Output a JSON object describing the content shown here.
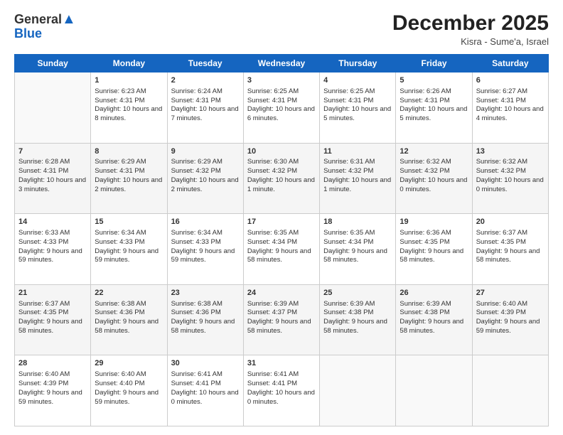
{
  "header": {
    "logo_general": "General",
    "logo_blue": "Blue",
    "month_title": "December 2025",
    "location": "Kisra - Sume'a, Israel"
  },
  "days_of_week": [
    "Sunday",
    "Monday",
    "Tuesday",
    "Wednesday",
    "Thursday",
    "Friday",
    "Saturday"
  ],
  "weeks": [
    [
      {
        "day": "",
        "content": ""
      },
      {
        "day": "1",
        "content": "Sunrise: 6:23 AM\nSunset: 4:31 PM\nDaylight: 10 hours and 8 minutes."
      },
      {
        "day": "2",
        "content": "Sunrise: 6:24 AM\nSunset: 4:31 PM\nDaylight: 10 hours and 7 minutes."
      },
      {
        "day": "3",
        "content": "Sunrise: 6:25 AM\nSunset: 4:31 PM\nDaylight: 10 hours and 6 minutes."
      },
      {
        "day": "4",
        "content": "Sunrise: 6:25 AM\nSunset: 4:31 PM\nDaylight: 10 hours and 5 minutes."
      },
      {
        "day": "5",
        "content": "Sunrise: 6:26 AM\nSunset: 4:31 PM\nDaylight: 10 hours and 5 minutes."
      },
      {
        "day": "6",
        "content": "Sunrise: 6:27 AM\nSunset: 4:31 PM\nDaylight: 10 hours and 4 minutes."
      }
    ],
    [
      {
        "day": "7",
        "content": "Sunrise: 6:28 AM\nSunset: 4:31 PM\nDaylight: 10 hours and 3 minutes."
      },
      {
        "day": "8",
        "content": "Sunrise: 6:29 AM\nSunset: 4:31 PM\nDaylight: 10 hours and 2 minutes."
      },
      {
        "day": "9",
        "content": "Sunrise: 6:29 AM\nSunset: 4:32 PM\nDaylight: 10 hours and 2 minutes."
      },
      {
        "day": "10",
        "content": "Sunrise: 6:30 AM\nSunset: 4:32 PM\nDaylight: 10 hours and 1 minute."
      },
      {
        "day": "11",
        "content": "Sunrise: 6:31 AM\nSunset: 4:32 PM\nDaylight: 10 hours and 1 minute."
      },
      {
        "day": "12",
        "content": "Sunrise: 6:32 AM\nSunset: 4:32 PM\nDaylight: 10 hours and 0 minutes."
      },
      {
        "day": "13",
        "content": "Sunrise: 6:32 AM\nSunset: 4:32 PM\nDaylight: 10 hours and 0 minutes."
      }
    ],
    [
      {
        "day": "14",
        "content": "Sunrise: 6:33 AM\nSunset: 4:33 PM\nDaylight: 9 hours and 59 minutes."
      },
      {
        "day": "15",
        "content": "Sunrise: 6:34 AM\nSunset: 4:33 PM\nDaylight: 9 hours and 59 minutes."
      },
      {
        "day": "16",
        "content": "Sunrise: 6:34 AM\nSunset: 4:33 PM\nDaylight: 9 hours and 59 minutes."
      },
      {
        "day": "17",
        "content": "Sunrise: 6:35 AM\nSunset: 4:34 PM\nDaylight: 9 hours and 58 minutes."
      },
      {
        "day": "18",
        "content": "Sunrise: 6:35 AM\nSunset: 4:34 PM\nDaylight: 9 hours and 58 minutes."
      },
      {
        "day": "19",
        "content": "Sunrise: 6:36 AM\nSunset: 4:35 PM\nDaylight: 9 hours and 58 minutes."
      },
      {
        "day": "20",
        "content": "Sunrise: 6:37 AM\nSunset: 4:35 PM\nDaylight: 9 hours and 58 minutes."
      }
    ],
    [
      {
        "day": "21",
        "content": "Sunrise: 6:37 AM\nSunset: 4:35 PM\nDaylight: 9 hours and 58 minutes."
      },
      {
        "day": "22",
        "content": "Sunrise: 6:38 AM\nSunset: 4:36 PM\nDaylight: 9 hours and 58 minutes."
      },
      {
        "day": "23",
        "content": "Sunrise: 6:38 AM\nSunset: 4:36 PM\nDaylight: 9 hours and 58 minutes."
      },
      {
        "day": "24",
        "content": "Sunrise: 6:39 AM\nSunset: 4:37 PM\nDaylight: 9 hours and 58 minutes."
      },
      {
        "day": "25",
        "content": "Sunrise: 6:39 AM\nSunset: 4:38 PM\nDaylight: 9 hours and 58 minutes."
      },
      {
        "day": "26",
        "content": "Sunrise: 6:39 AM\nSunset: 4:38 PM\nDaylight: 9 hours and 58 minutes."
      },
      {
        "day": "27",
        "content": "Sunrise: 6:40 AM\nSunset: 4:39 PM\nDaylight: 9 hours and 59 minutes."
      }
    ],
    [
      {
        "day": "28",
        "content": "Sunrise: 6:40 AM\nSunset: 4:39 PM\nDaylight: 9 hours and 59 minutes."
      },
      {
        "day": "29",
        "content": "Sunrise: 6:40 AM\nSunset: 4:40 PM\nDaylight: 9 hours and 59 minutes."
      },
      {
        "day": "30",
        "content": "Sunrise: 6:41 AM\nSunset: 4:41 PM\nDaylight: 10 hours and 0 minutes."
      },
      {
        "day": "31",
        "content": "Sunrise: 6:41 AM\nSunset: 4:41 PM\nDaylight: 10 hours and 0 minutes."
      },
      {
        "day": "",
        "content": ""
      },
      {
        "day": "",
        "content": ""
      },
      {
        "day": "",
        "content": ""
      }
    ]
  ]
}
